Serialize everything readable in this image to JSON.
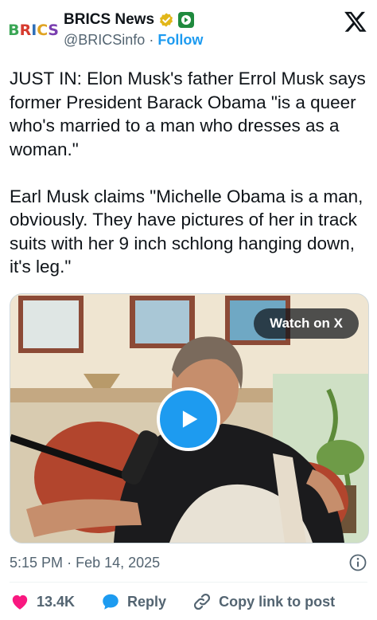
{
  "account": {
    "avatar_text": [
      "B",
      "R",
      "I",
      "C",
      "S"
    ],
    "avatar_colors": [
      "#3aa655",
      "#d63b2f",
      "#2f6fb8",
      "#e0a321",
      "#7a3fb0"
    ],
    "name": "BRICS News",
    "handle": "@BRICSinfo",
    "separator": "·",
    "follow_label": "Follow"
  },
  "icons": {
    "verified": "gold-verified-badge-icon",
    "affiliate": "affiliate-badge-icon",
    "platform": "x-logo-icon"
  },
  "tweet": {
    "paragraph_1": "JUST IN: Elon Musk's father Errol Musk says former President Barack Obama \"is a queer who's married to a man who dresses as a woman.\"",
    "paragraph_2": "Earl Musk claims \"Michelle Obama is a man, obviously. They have pictures of her in track suits with her 9 inch schlong hanging down, it's leg.\""
  },
  "video": {
    "watch_label": "Watch on X",
    "play_icon": "play-icon"
  },
  "meta": {
    "time": "5:15 PM",
    "separator": "·",
    "date": "Feb 14, 2025"
  },
  "actions": {
    "likes": "13.4K",
    "reply_label": "Reply",
    "copy_link_label": "Copy link to post"
  },
  "colors": {
    "accent": "#1d9bf0",
    "like": "#f91880",
    "muted": "#536471",
    "verified_gold": "#e2b719"
  }
}
